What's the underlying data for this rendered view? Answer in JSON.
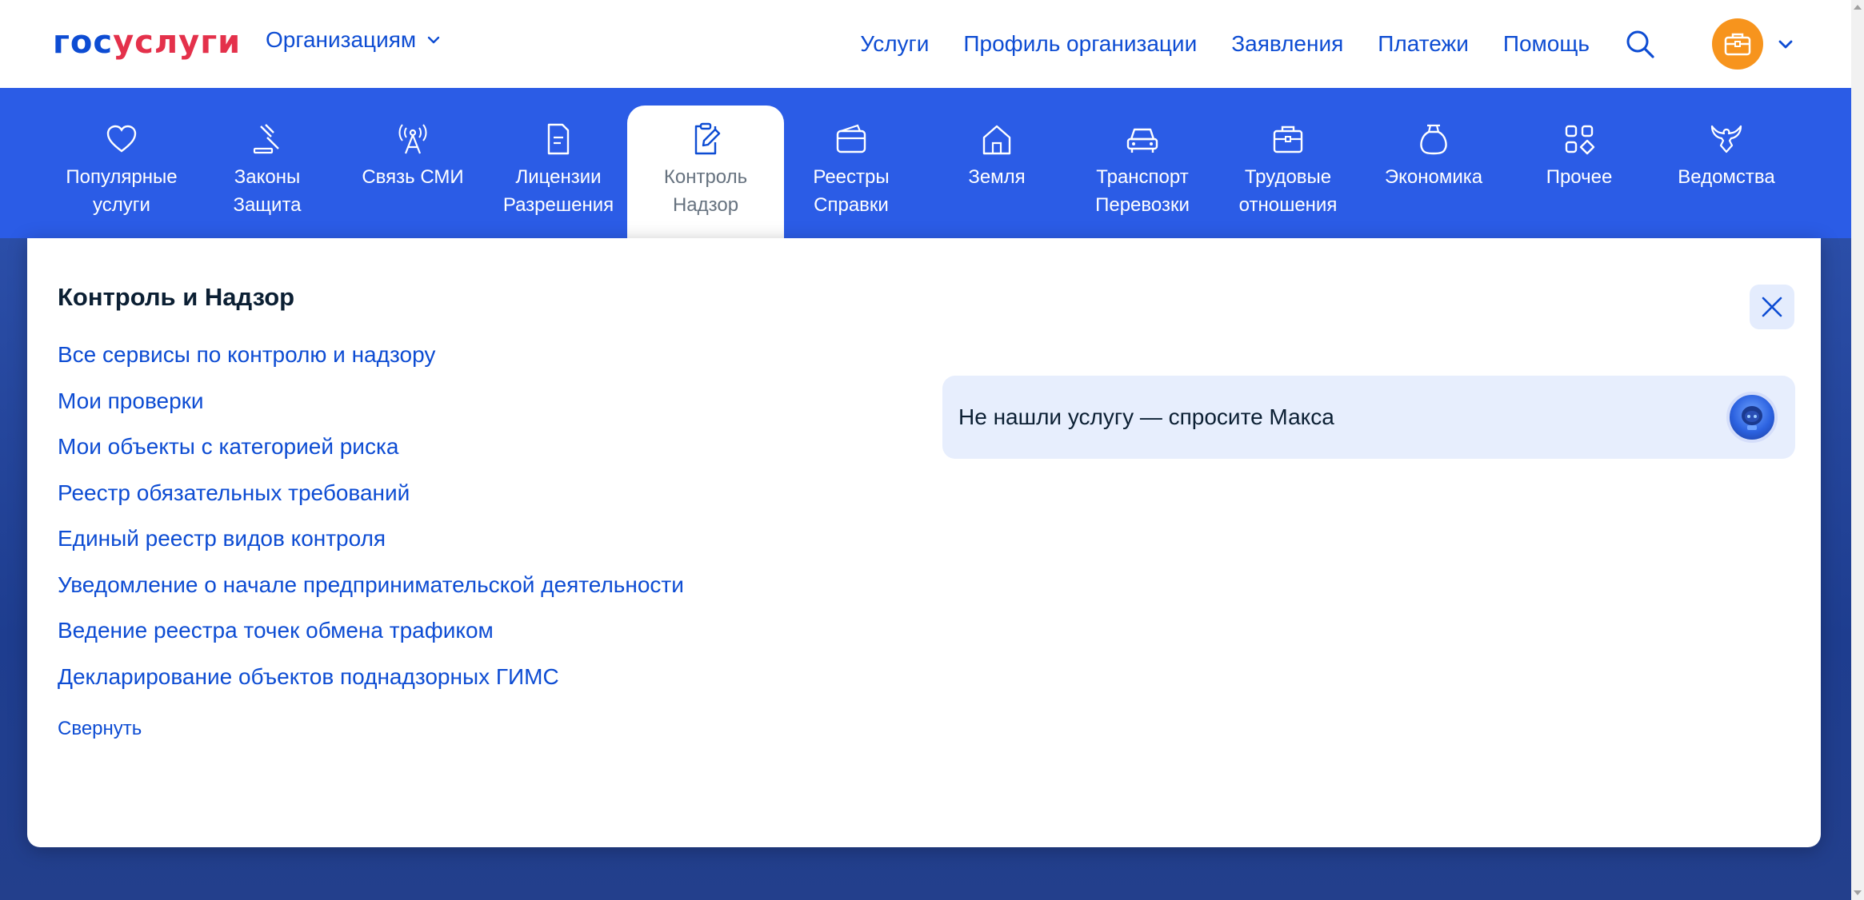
{
  "header": {
    "logo_part1": "гос",
    "logo_part2": "услуги",
    "org_menu_label": "Организациям",
    "nav": [
      "Услуги",
      "Профиль организации",
      "Заявления",
      "Платежи",
      "Помощь"
    ]
  },
  "categories": [
    {
      "label": "Популярные\nуслуги",
      "icon": "heart-icon"
    },
    {
      "label": "Законы\nЗащита",
      "icon": "gavel-icon"
    },
    {
      "label": "Связь СМИ",
      "icon": "antenna-icon"
    },
    {
      "label": "Лицензии\nРазрешения",
      "icon": "document-icon"
    },
    {
      "label": "Контроль\nНадзор",
      "icon": "clipboard-edit-icon",
      "active": true
    },
    {
      "label": "Реестры\nСправки",
      "icon": "wallet-icon"
    },
    {
      "label": "Земля",
      "icon": "house-icon"
    },
    {
      "label": "Транспорт\nПеревозки",
      "icon": "car-icon"
    },
    {
      "label": "Трудовые\nотношения",
      "icon": "briefcase-icon"
    },
    {
      "label": "Экономика",
      "icon": "money-bag-icon"
    },
    {
      "label": "Прочее",
      "icon": "grid-icon"
    },
    {
      "label": "Ведомства",
      "icon": "eagle-icon"
    }
  ],
  "panel": {
    "title": "Контроль и Надзор",
    "links": [
      "Все сервисы по контролю и надзору",
      "Мои проверки",
      "Мои объекты с категорией риска",
      "Реестр обязательных требований",
      "Единый реестр видов контроля",
      "Уведомление о начале предпринимательской деятельности",
      "Ведение реестра точек обмена трафиком",
      "Декларирование объектов поднадзорных ГИМС"
    ],
    "collapse_label": "Свернуть",
    "ask_text": "Не нашли услугу — спросите Макса"
  },
  "colors": {
    "brand_blue": "#0d4cd3",
    "brand_red": "#e4314b",
    "catbar_blue": "#2b5ce6",
    "avatar_orange": "#f7941d"
  }
}
